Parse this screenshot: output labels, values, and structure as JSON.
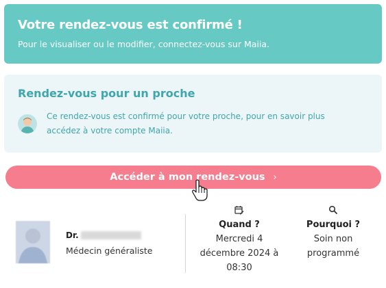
{
  "banner": {
    "title": "Votre rendez-vous est confirmé !",
    "subtitle": "Pour le visualiser ou le modifier, connectez-vous sur Maiia."
  },
  "relative": {
    "title": "Rendez-vous pour un proche",
    "text_line1": "Ce rendez-vous est confirmé pour votre proche, pour en savoir plus",
    "text_line2": "accédez à votre compte Maiia."
  },
  "cta": {
    "label": "Accéder à mon rendez-vous",
    "chevron": "›"
  },
  "doctor": {
    "prefix": "Dr.",
    "specialty": "Médecin généraliste"
  },
  "when": {
    "icon": "calendar-edit-icon",
    "label": "Quand ?",
    "line1": "Mercredi 4",
    "line2": "décembre 2024 à",
    "line3": "08:30"
  },
  "why": {
    "icon": "search-icon",
    "label": "Pourquoi ?",
    "line1": "Soin non",
    "line2": "programmé"
  },
  "colors": {
    "banner": "#67c9c3",
    "accent": "#3fa6ad",
    "card": "#ecf5f7",
    "cta": "#f67d8d"
  }
}
